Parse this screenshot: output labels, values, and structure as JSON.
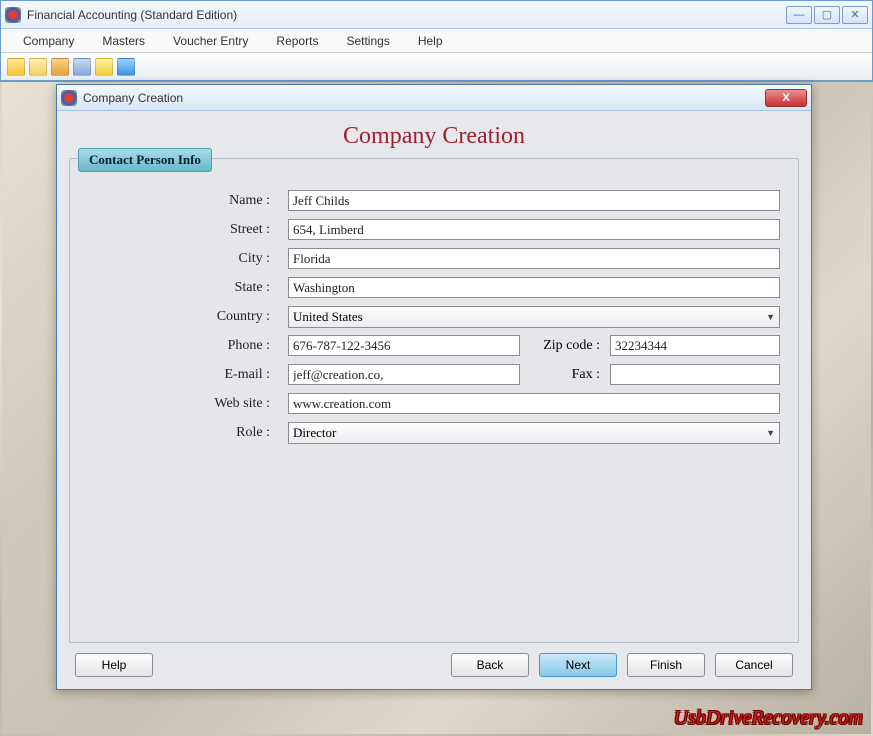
{
  "app": {
    "title": "Financial Accounting (Standard Edition)"
  },
  "menu": {
    "items": [
      "Company",
      "Masters",
      "Voucher Entry",
      "Reports",
      "Settings",
      "Help"
    ]
  },
  "toolbarIcons": [
    "folder-icon",
    "edit-icon",
    "grid-icon",
    "chart-icon",
    "tag-icon",
    "blue-panel-icon"
  ],
  "dialog": {
    "title": "Company Creation",
    "heading": "Company Creation",
    "tab": "Contact Person Info",
    "labels": {
      "name": "Name :",
      "street": "Street :",
      "city": "City :",
      "state": "State :",
      "country": "Country :",
      "phone": "Phone :",
      "zip": "Zip code :",
      "email": "E-mail :",
      "fax": "Fax :",
      "website": "Web site :",
      "role": "Role :"
    },
    "values": {
      "name": "Jeff Childs",
      "street": "654, Limberd",
      "city": "Florida",
      "state": "Washington",
      "country": "United States",
      "phone": "676-787-122-3456",
      "zip": "32234344",
      "email": "jeff@creation.co,",
      "fax": "",
      "website": "www.creation.com",
      "role": "Director"
    },
    "buttons": {
      "help": "Help",
      "back": "Back",
      "next": "Next",
      "finish": "Finish",
      "cancel": "Cancel"
    }
  },
  "watermark": "UsbDriveRecovery.com"
}
